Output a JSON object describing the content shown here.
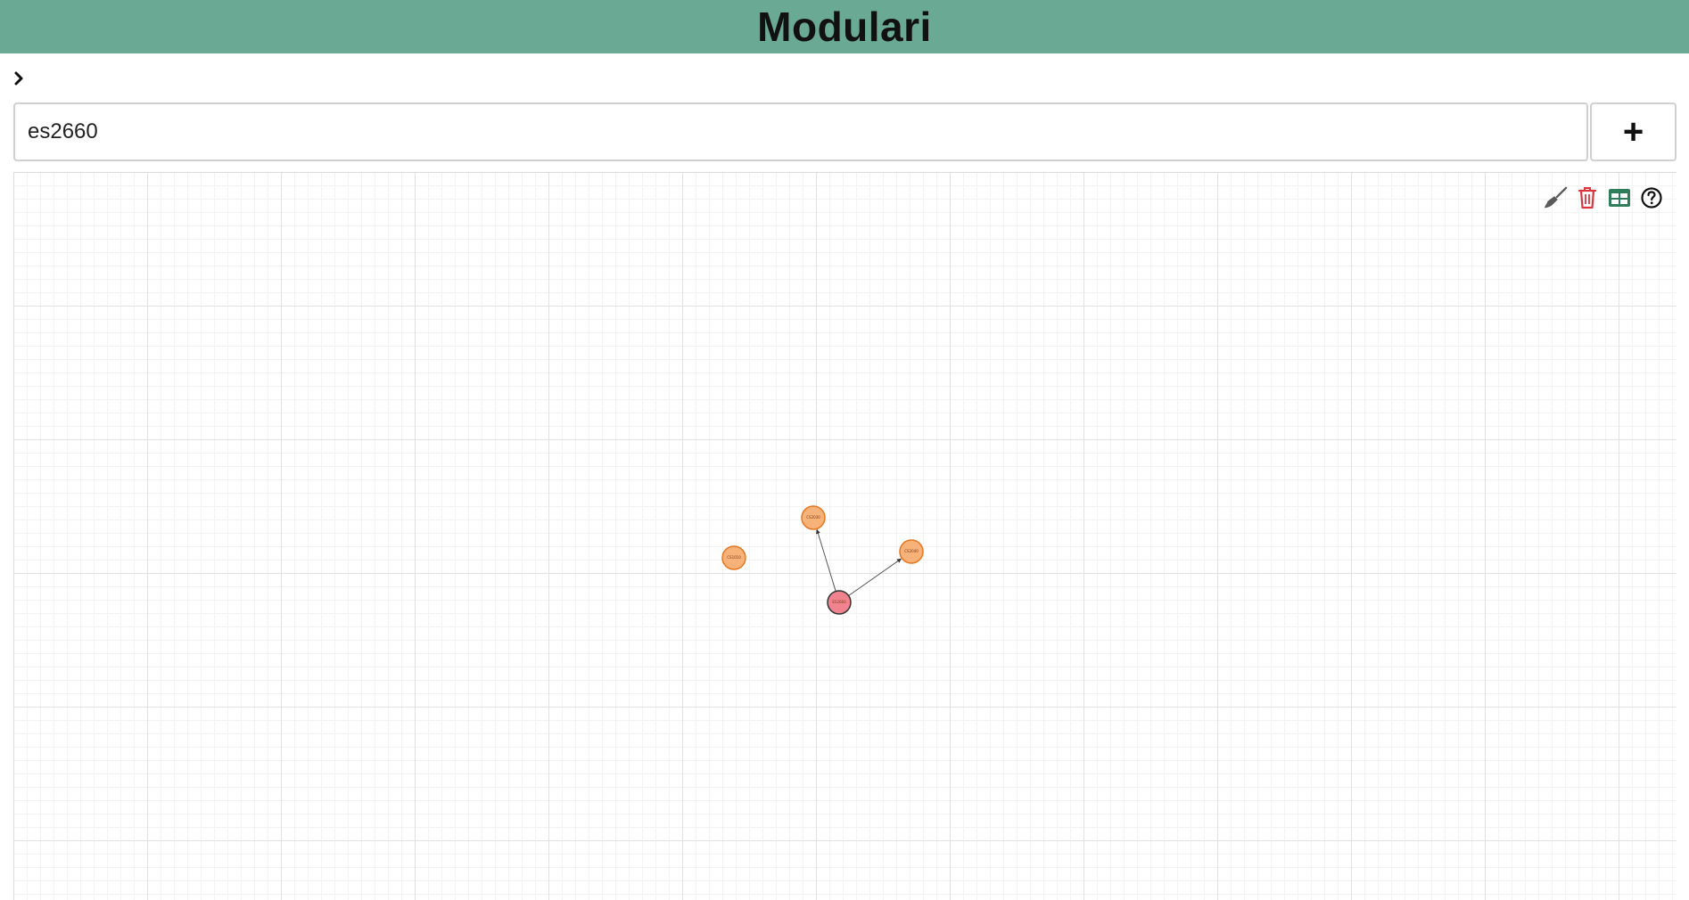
{
  "app": {
    "title": "Modulari"
  },
  "sidebar_toggle": {
    "icon": "chevron-right-icon"
  },
  "search": {
    "value": "es2660",
    "add_button_label": "+"
  },
  "toolbar": {
    "items": [
      {
        "name": "clear-brush-icon",
        "color": "#5a5a5a"
      },
      {
        "name": "trash-icon",
        "color": "#d9363e"
      },
      {
        "name": "table-icon",
        "color": "#2f7d5b"
      },
      {
        "name": "help-icon",
        "color": "#111111"
      }
    ]
  },
  "graph": {
    "colors": {
      "module_fill": "#f7b27a",
      "module_stroke": "#e8761f",
      "selected_fill": "#f1838f",
      "selected_stroke": "#333333",
      "edge": "#555555"
    },
    "nodes": [
      {
        "id": "n1",
        "label": "CS2030",
        "type": "module"
      },
      {
        "id": "n2",
        "label": "CS2040",
        "type": "module"
      },
      {
        "id": "n3",
        "label": "CS1010",
        "type": "module"
      },
      {
        "id": "n4",
        "label": "ES2660",
        "type": "selected"
      }
    ],
    "edges": [
      {
        "from": "n4",
        "to": "n1"
      },
      {
        "from": "n4",
        "to": "n2"
      }
    ]
  }
}
